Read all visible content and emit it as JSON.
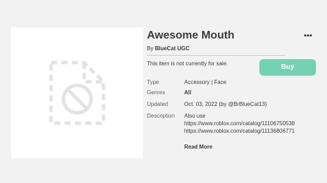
{
  "item": {
    "title": "Awesome Mouth",
    "by_prefix": "By ",
    "creator": "BlueCat UGC",
    "sale_status": "This item is not currently for sale.",
    "buy_label": "Buy",
    "colors": {
      "buy_button": "#76d1b3",
      "background": "#f2f2f3",
      "text": "#393b3d"
    }
  },
  "info": {
    "type_label": "Type",
    "type_value": "Accessory | Face",
    "genres_label": "Genres",
    "genres_value": "All",
    "updated_label": "Updated",
    "updated_value": "Oct. 03, 2022 (by ",
    "updated_by": "@BrBlueCat13",
    "updated_suffix": ")",
    "description_label": "Description",
    "description_lines": [
      "Also use",
      "https://www.roblox.com/catalog/11106750538",
      "https://www.roblox.com/catalog/11136806771"
    ],
    "read_more": "Read More"
  },
  "icons": {
    "thumbnail": "unavailable-file-icon",
    "more": "more-options-icon"
  }
}
